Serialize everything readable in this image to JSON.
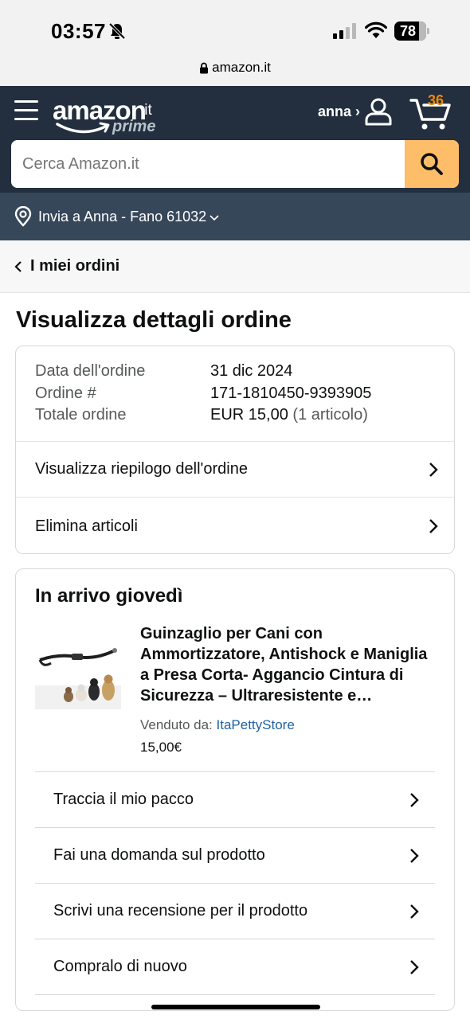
{
  "status_bar": {
    "time": "03:57",
    "battery": "78"
  },
  "browser": {
    "url": "amazon.it"
  },
  "header": {
    "logo_word": "amazon",
    "logo_tld": ".it",
    "logo_prime": "prime",
    "account_label": "anna ›",
    "cart_count": "36",
    "search_placeholder": "Cerca Amazon.it",
    "delivery_text": "Invia a Anna - Fano 61032"
  },
  "breadcrumb": {
    "label": "I miei ordini"
  },
  "page": {
    "title": "Visualizza dettagli ordine"
  },
  "order": {
    "date_label": "Data dell'ordine",
    "date_value": "31 dic 2024",
    "number_label": "Ordine #",
    "number_value": "171-1810450-9393905",
    "total_label": "Totale ordine",
    "total_value": "EUR 15,00",
    "total_items": "(1 articolo)",
    "summary_link": "Visualizza riepilogo dell'ordine",
    "delete_link": "Elimina articoli"
  },
  "shipment": {
    "title": "In arrivo giovedì",
    "product_title": "Guinzaglio per Cani con Ammortizzatore, Antishock e Maniglia a Presa Corta- Aggancio Cintura di Sicurezza – Ultraresistente e Riflettente",
    "sold_by_label": "Venduto da:",
    "seller": "ItaPettyStore",
    "price": "15,00€",
    "actions": [
      "Traccia il mio pacco",
      "Fai una domanda sul prodotto",
      "Scrivi una recensione per il prodotto",
      "Compralo di nuovo"
    ]
  },
  "colors": {
    "header_bg": "#232f3e",
    "delivery_bg": "#37475a",
    "search_button": "#febd69",
    "cart_count": "#f08804",
    "link": "#2162a1"
  },
  "icons": [
    "bell-slash-icon",
    "signal-icon",
    "wifi-icon",
    "lock-icon",
    "menu-icon",
    "user-icon",
    "cart-icon",
    "search-icon",
    "location-pin-icon",
    "chevron-left-icon",
    "chevron-right-icon"
  ]
}
